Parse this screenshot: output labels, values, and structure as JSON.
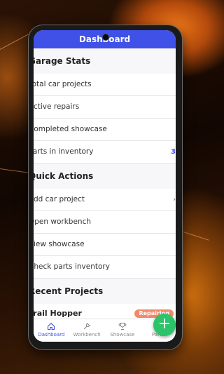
{
  "appbar": {
    "title": "Dashboard"
  },
  "garage_stats": {
    "title": "Garage Stats",
    "rows": [
      {
        "label": "Total car projects",
        "value": ""
      },
      {
        "label": "Active repairs",
        "value": ""
      },
      {
        "label": "Completed showcase",
        "value": ""
      },
      {
        "label": "Parts in inventory",
        "value": "3"
      }
    ]
  },
  "quick_actions": {
    "title": "Quick Actions",
    "rows": [
      {
        "label": "Add car project"
      },
      {
        "label": "Open workbench"
      },
      {
        "label": "View showcase"
      },
      {
        "label": "Check parts inventory"
      }
    ]
  },
  "recent_projects": {
    "title": "Recent Projects",
    "items": [
      {
        "name": "Trail Hopper",
        "status": "Repairing"
      }
    ]
  },
  "fab": {
    "icon": "plus-icon",
    "symbol": "+"
  },
  "bottom_nav": {
    "items": [
      {
        "label": "Dashboard",
        "icon": "home-icon"
      },
      {
        "label": "Workbench",
        "icon": "wrench-icon"
      },
      {
        "label": "Showcase",
        "icon": "trophy-icon"
      },
      {
        "label": "Parts",
        "icon": "grid-icon"
      }
    ]
  },
  "colors": {
    "accent": "#3f51e6",
    "fab": "#2bc46a",
    "badge": "#f08a6b"
  }
}
